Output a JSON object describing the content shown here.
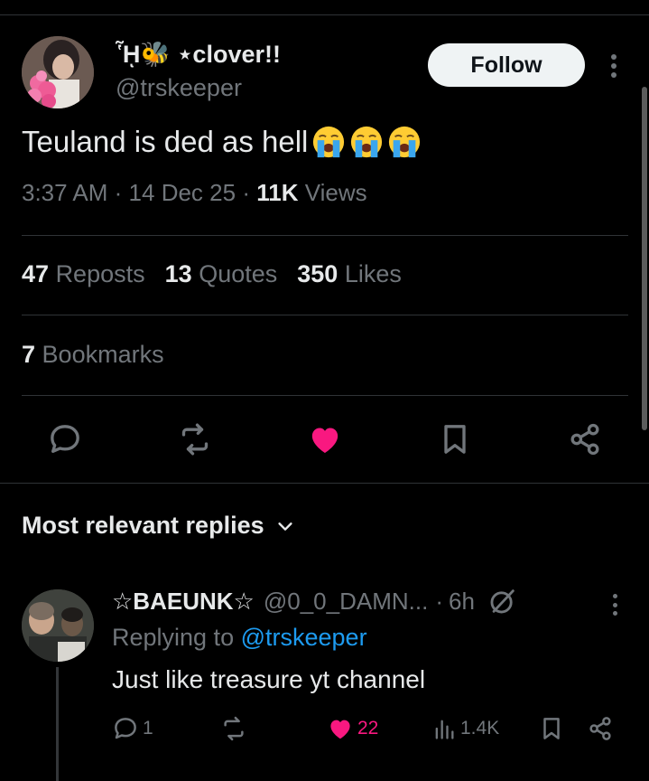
{
  "tweet": {
    "display_name": "ᾟ🐝 ⋆clover!!",
    "handle": "@trskeeper",
    "follow_label": "Follow",
    "text": "Teuland is ded as hell",
    "emoji_count": 3,
    "emoji_name": "loudly-crying-face",
    "time": "3:37 AM",
    "date": "14 Dec 25",
    "views_count": "11K",
    "views_label": "Views",
    "sep": "·",
    "reposts_count": "47",
    "reposts_label": "Reposts",
    "quotes_count": "13",
    "quotes_label": "Quotes",
    "likes_count": "350",
    "likes_label": "Likes",
    "bookmarks_count": "7",
    "bookmarks_label": "Bookmarks",
    "actions": [
      "reply-icon",
      "repost-icon",
      "heart-icon",
      "bookmark-icon",
      "share-icon"
    ],
    "liked": true
  },
  "replies_section": {
    "title": "Most relevant replies"
  },
  "replies": [
    {
      "display_name": "☆BAEUNK☆",
      "handle": "@0_0_DAMN...",
      "sep": "·",
      "time": "6h",
      "replying_prefix": "Replying to",
      "replying_to": "@trskeeper",
      "text": "Just like treasure yt channel",
      "reply_count": "1",
      "like_count": "22",
      "views": "1.4K",
      "liked": true
    }
  ],
  "colors": {
    "background": "#000000",
    "text_primary": "#e7e9ea",
    "text_secondary": "#71767b",
    "divider": "#2f3336",
    "like_pink": "#f91880",
    "link_blue": "#1d9bf0",
    "follow_bg": "#eff3f4"
  }
}
